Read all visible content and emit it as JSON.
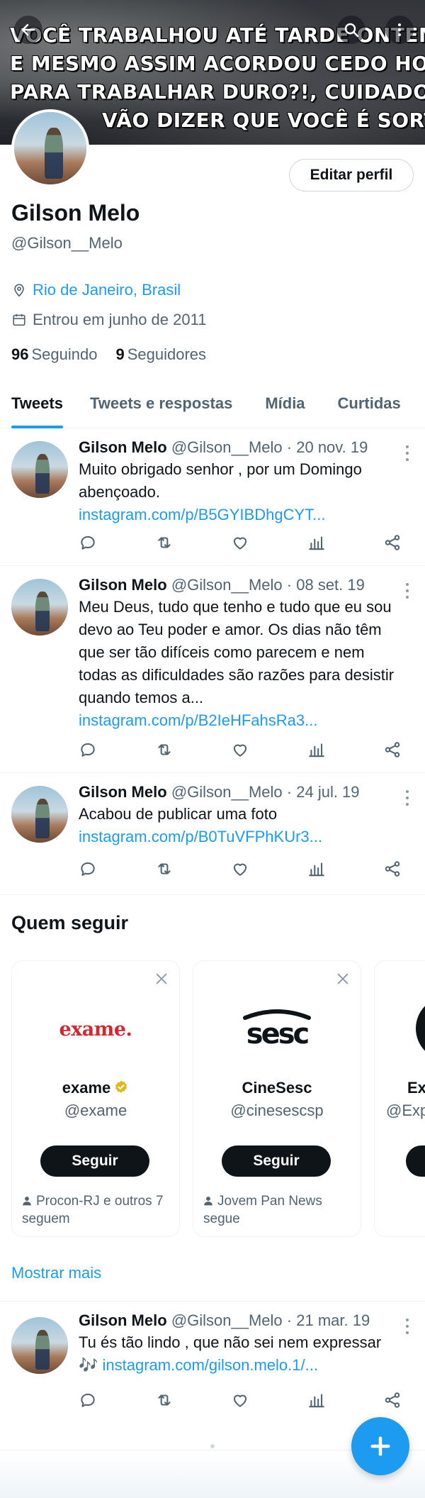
{
  "banner": {
    "lines": [
      "VOCÊ TRABALHOU ATÉ TARDE ONTEM?",
      "E MESMO ASSIM ACORDOU CEDO HOJE",
      "PARA TRABALHAR DURO?!, CUIDADO!",
      "VÃO DIZER QUE VOCÊ É SORTUDO."
    ]
  },
  "profile": {
    "edit_label": "Editar perfil",
    "name": "Gilson Melo",
    "handle": "@Gilson__Melo",
    "location": "Rio de Janeiro, Brasil",
    "joined": "Entrou em junho de 2011",
    "following_count": "96",
    "following_label": "Seguindo",
    "followers_count": "9",
    "followers_label": "Seguidores"
  },
  "tabs": [
    "Tweets",
    "Tweets e respostas",
    "Mídia",
    "Curtidas"
  ],
  "tweets": [
    {
      "name": "Gilson Melo",
      "handle": "@Gilson__Melo",
      "date": "· 20 nov. 19",
      "text": "Muito obrigado senhor , por um Domingo abençoado.",
      "link": "instagram.com/p/B5GYIBDhgCYT..."
    },
    {
      "name": "Gilson Melo",
      "handle": "@Gilson__Melo",
      "date": "· 08 set. 19",
      "text": "Meu Deus, tudo que tenho e tudo que eu sou devo ao Teu poder e amor. Os dias não têm que ser tão difíceis como parecem e nem todas as dificuldades são razões para desistir quando temos a...",
      "link": "instagram.com/p/B2IeHFahsRa3..."
    },
    {
      "name": "Gilson Melo",
      "handle": "@Gilson__Melo",
      "date": "· 24 jul. 19",
      "text": "Acabou de publicar uma foto",
      "link": "instagram.com/p/B0TuVFPhKUr3..."
    },
    {
      "name": "Gilson Melo",
      "handle": "@Gilson__Melo",
      "date": "· 21 mar. 19",
      "text": "Tu és tão lindo , que não sei nem expressar",
      "link": "🎶 instagram.com/gilson.melo.1/..."
    }
  ],
  "who_to_follow": {
    "title": "Quem seguir",
    "follow_label": "Seguir",
    "cards": [
      {
        "name": "exame",
        "handle": "@exame",
        "logo": "exame.",
        "social": "Procon-RJ e outros 7 seguem",
        "verified_color": "#e2b719"
      },
      {
        "name": "CineSesc",
        "handle": "@cinesescsp",
        "logo": "sesc",
        "social": "Jovem Pan News segue"
      },
      {
        "name": "Ex",
        "handle": "@Exp",
        "logo": ""
      }
    ],
    "show_more": "Mostrar mais"
  },
  "colors": {
    "accent": "#1d9bf0",
    "exame_red": "#d3282f"
  }
}
